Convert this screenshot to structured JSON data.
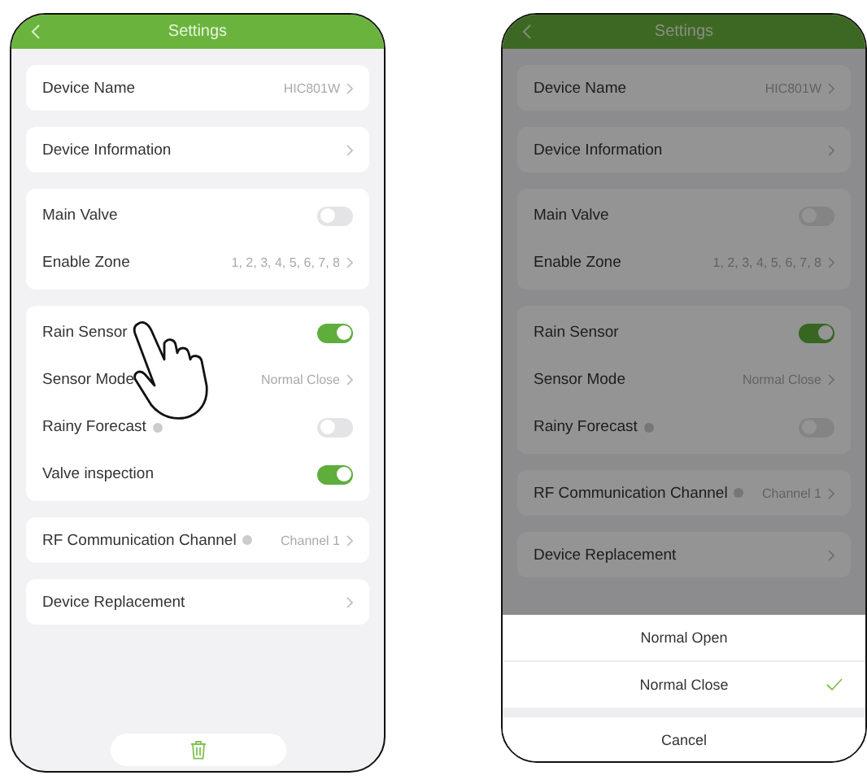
{
  "phones": [
    {
      "title": "Settings",
      "groups": [
        [
          {
            "kind": "link",
            "label": "Device Name",
            "value": "HIC801W",
            "info": false
          }
        ],
        [
          {
            "kind": "link",
            "label": "Device Information",
            "info": false
          }
        ],
        [
          {
            "kind": "toggle",
            "label": "Main Valve",
            "on": false,
            "info": false
          },
          {
            "kind": "link",
            "label": "Enable Zone",
            "value": "1, 2, 3, 4, 5, 6, 7, 8",
            "info": false
          }
        ],
        [
          {
            "kind": "toggle",
            "label": "Rain Sensor",
            "on": true,
            "info": false
          },
          {
            "kind": "link",
            "label": "Sensor Mode",
            "value": "Normal Close",
            "info": false
          },
          {
            "kind": "toggle",
            "label": "Rainy Forecast",
            "on": false,
            "info": true
          },
          {
            "kind": "toggle",
            "label": "Valve inspection",
            "on": true,
            "info": false
          }
        ],
        [
          {
            "kind": "link",
            "label": "RF Communication Channel",
            "value": "Channel 1",
            "info": true
          }
        ],
        [
          {
            "kind": "link",
            "label": "Device Replacement",
            "info": false
          }
        ]
      ]
    },
    {
      "title": "Settings",
      "groups": [
        [
          {
            "kind": "link",
            "label": "Device Name",
            "value": "HIC801W",
            "info": false
          }
        ],
        [
          {
            "kind": "link",
            "label": "Device Information",
            "info": false
          }
        ],
        [
          {
            "kind": "toggle",
            "label": "Main Valve",
            "on": false,
            "info": false
          },
          {
            "kind": "link",
            "label": "Enable Zone",
            "value": "1, 2, 3, 4, 5, 6, 7, 8",
            "info": false
          }
        ],
        [
          {
            "kind": "toggle",
            "label": "Rain Sensor",
            "on": true,
            "info": false
          },
          {
            "kind": "link",
            "label": "Sensor Mode",
            "value": "Normal Close",
            "info": false
          },
          {
            "kind": "toggle",
            "label": "Rainy Forecast",
            "on": false,
            "info": true
          }
        ],
        [
          {
            "kind": "link",
            "label": "RF Communication Channel",
            "value": "Channel 1",
            "info": true
          }
        ],
        [
          {
            "kind": "link",
            "label": "Device Replacement",
            "info": false
          }
        ]
      ],
      "sheet": {
        "options": [
          {
            "label": "Normal Open",
            "selected": false
          },
          {
            "label": "Normal Close",
            "selected": true
          }
        ],
        "cancel": "Cancel"
      }
    }
  ]
}
